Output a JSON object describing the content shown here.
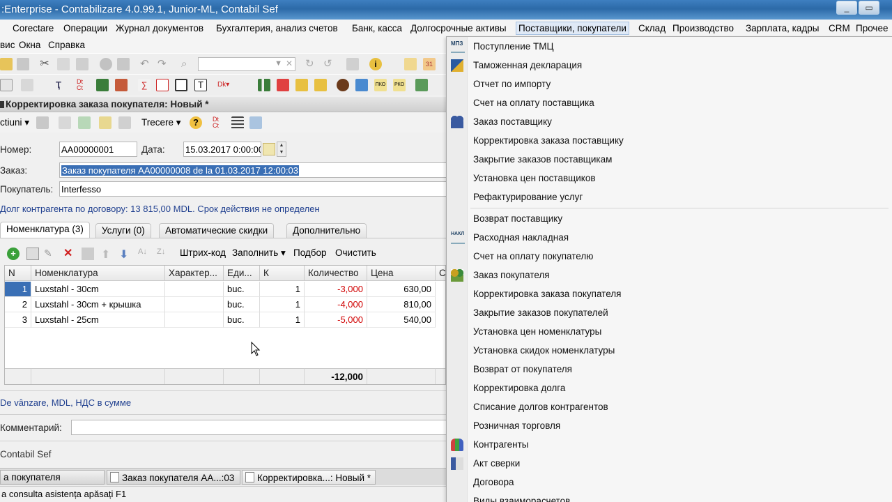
{
  "window": {
    "title": ":Enterprise - Contabilizare 4.0.99.1, Junior-ML, Contabil Sef"
  },
  "menu_main": [
    "Corectare",
    "Операции",
    "Журнал документов",
    "Бухгалтерия, анализ счетов",
    "Банк, касса",
    "Долгосрочные активы",
    "Поставщики, покупатели",
    "Склад",
    "Производство",
    "Зарплата, кадры",
    "CRM",
    "Прочее"
  ],
  "menu_second": [
    "вис",
    "Окна",
    "Справка"
  ],
  "form": {
    "title": "Корректировка заказа покупателя: Новый *",
    "toolbar": {
      "actions_label": "ctiuni",
      "trecere_label": "Trecere"
    },
    "number_label": "Номер:",
    "number_value": "АА00000001",
    "date_label": "Дата:",
    "date_value": "15.03.2017  0:00:00",
    "order_label": "Заказ:",
    "order_value": "Заказ покупателя АА00000008 de la 01.03.2017 12:00:03",
    "buyer_label": "Покупатель:",
    "buyer_value": "Interfesso",
    "debt_text": "Долг контрагента по договору: 13 815,00 MDL. Срок действия не определен",
    "tabs": [
      "Номенклатура (3)",
      "Услуги (0)",
      "Автоматические скидки",
      "Дополнительно"
    ],
    "grid_toolbar": [
      "Штрих-код",
      "Заполнить",
      "Подбор",
      "Очистить"
    ],
    "grid": {
      "headers": [
        "N",
        "Номенклатура",
        "Характер...",
        "Еди...",
        "К",
        "Количество",
        "Цена",
        "С"
      ],
      "rows": [
        [
          "1",
          "Luxstahl - 30cm",
          "",
          "buc.",
          "1",
          "-3,000",
          "630,00"
        ],
        [
          "2",
          "Luxstahl - 30cm + крышка",
          "",
          "buc.",
          "1",
          "-4,000",
          "810,00"
        ],
        [
          "3",
          "Luxstahl - 25cm",
          "",
          "buc.",
          "1",
          "-5,000",
          "540,00"
        ]
      ],
      "total_qty": "-12,000"
    },
    "price_type_text": "De vânzare, MDL, НДС в сумме",
    "comment_label": "Комментарий:",
    "responsible_text": "Contabil Sef"
  },
  "taskbar": [
    "а покупателя",
    "Заказ покупателя АА...:03",
    "Корректировка...: Новый *"
  ],
  "status": "a consulta asistența apăsați F1",
  "dropdown": {
    "group1": [
      "Поступление ТМЦ",
      "Таможенная декларация",
      "Отчет по импорту",
      "Счет на оплату поставщика",
      "Заказ поставщику",
      "Корректировка заказа поставщику",
      "Закрытие заказов поставщикам",
      "Установка цен поставщиков",
      "Рефактурирование услуг"
    ],
    "group2": [
      "Возврат поставщику",
      "Расходная накладная",
      "Счет на оплату покупателю",
      "Заказ покупателя",
      "Корректировка заказа покупателя",
      "Закрытие заказов покупателей",
      "Установка цен номенклатуры",
      "Установка скидок номенклатуры",
      "Возврат от покупателя",
      "Корректировка долга",
      "Списание долгов контрагентов",
      "Розничная торговля",
      "Контрагенты",
      "Акт сверки",
      "Договора",
      "Виды взаиморасчетов"
    ],
    "icon_mpz": "МПЗ",
    "icon_nakl": "НАКЛ"
  }
}
